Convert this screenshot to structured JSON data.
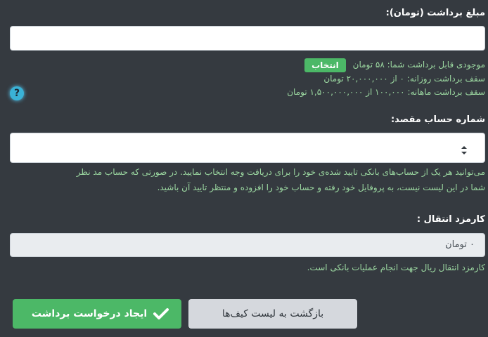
{
  "form": {
    "amount_label": "مبلغ برداشت (تومان):",
    "amount_value": "",
    "balance_text": "موجودی قابل برداشت شما: ۵۸ تومان",
    "pick_button": "انتخاب",
    "daily_limit": "سقف برداشت روزانه: ۰ از ۲۰,۰۰۰,۰۰۰ تومان",
    "monthly_limit": "سقف برداشت ماهانه: ۱۰۰,۰۰۰ از ۱,۵۰۰,۰۰۰,۰۰۰ تومان",
    "help_glyph": "?",
    "account_label": "شماره حساب مقصد:",
    "account_value": "",
    "account_desc_1": "می‌توانید هر یک از حساب‌های بانکی تایید شده‌ی خود را برای دریافت وجه انتخاب نمایید. در صورتی که حساب مد نظر",
    "account_desc_2": "شما در این لیست نیست، به پروفایل خود رفته و حساب خود را افزوده و منتظر تایید آن باشید.",
    "fee_label": "کارمزد انتقال :",
    "fee_value": "۰ تومان",
    "fee_desc": "کارمزد انتقال ریال جهت انجام عملیات بانکی است."
  },
  "actions": {
    "submit_label": "ایجاد درخواست برداشت",
    "back_label": "بازگشت به لیست کیف‌ها"
  },
  "colors": {
    "background": "#353a40",
    "accent_green": "#4cb867",
    "info_text": "#9bd7a0",
    "help_icon": "#3ab2d6"
  },
  "icons": [
    "help-icon",
    "select-arrows-icon",
    "check-icon"
  ]
}
